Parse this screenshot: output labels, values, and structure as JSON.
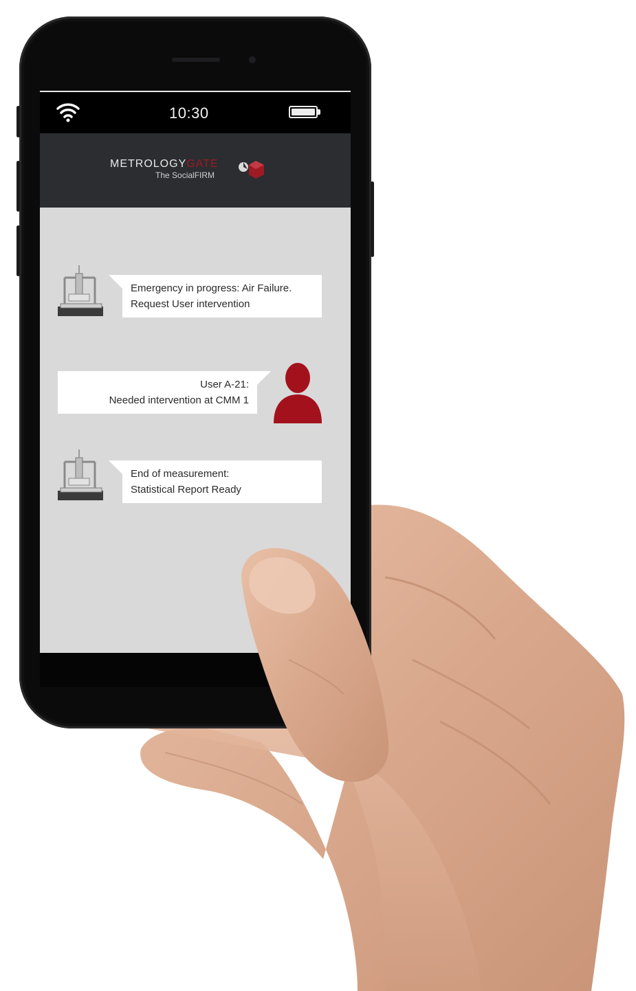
{
  "status_bar": {
    "time": "10:30",
    "icons": [
      "wifi-icon",
      "battery-icon"
    ]
  },
  "header": {
    "logo_primary": "METROLOGY",
    "logo_accent": "GATE",
    "logo_tagline": "The SocialFIRM",
    "accent_color": "#9e1b24"
  },
  "messages": [
    {
      "sender": "machine",
      "icon": "cmm-machine-icon",
      "line1": "Emergency in progress: Air Failure.",
      "line2": "Request User intervention"
    },
    {
      "sender": "user",
      "icon": "user-avatar-icon",
      "line1": "User A-21:",
      "line2": "Needed intervention at CMM 1"
    },
    {
      "sender": "machine",
      "icon": "cmm-machine-icon",
      "line1": "End of measurement:",
      "line2": "Statistical Report Ready"
    }
  ],
  "colors": {
    "screen_bg": "#d9d9da",
    "header_bg": "#2b2d31",
    "user_icon": "#a3121c"
  }
}
